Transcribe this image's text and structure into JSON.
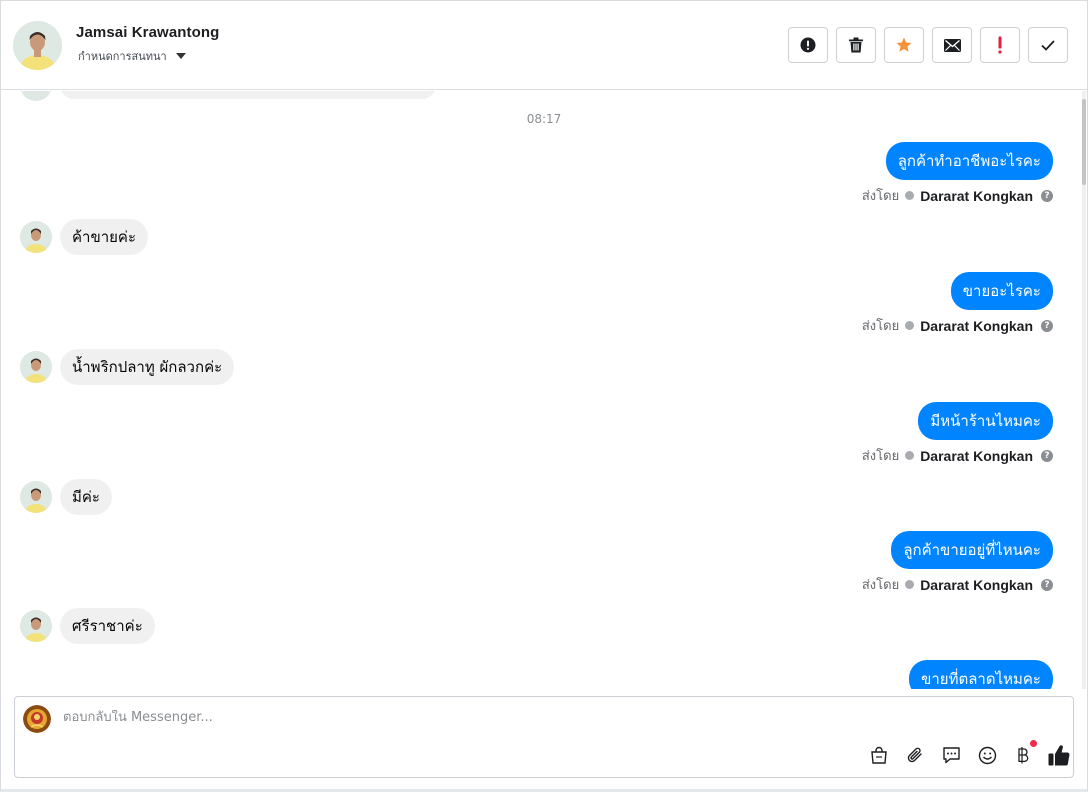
{
  "header": {
    "contact_name": "Jamsai Krawantong",
    "conversation_setting": "กำหนดการสนทนา",
    "actions": [
      {
        "name": "report-spam-button",
        "icon": "alert-circle-icon"
      },
      {
        "name": "delete-button",
        "icon": "trash-icon"
      },
      {
        "name": "star-button",
        "icon": "star-icon"
      },
      {
        "name": "mark-unread-button",
        "icon": "envelope-icon"
      },
      {
        "name": "follow-up-button",
        "icon": "exclamation-icon"
      },
      {
        "name": "mark-done-button",
        "icon": "check-icon"
      }
    ]
  },
  "chat": {
    "timestamp": "08:17",
    "sent_by_label": "ส่งโดย",
    "agent_name": "Dararat Kongkan",
    "help_glyph": "?",
    "messages": [
      {
        "dir": "out",
        "text": "ลูกค้าทำอาชีพอะไรคะ"
      },
      {
        "dir": "in",
        "text": "ค้าขายค่ะ"
      },
      {
        "dir": "out",
        "text": "ขายอะไรคะ"
      },
      {
        "dir": "in",
        "text": "น้ำพริกปลาทู ผักลวกค่ะ"
      },
      {
        "dir": "out",
        "text": "มีหน้าร้านไหมคะ"
      },
      {
        "dir": "in",
        "text": "มีค่ะ"
      },
      {
        "dir": "out",
        "text": "ลูกค้าขายอยู่ที่ไหนคะ"
      },
      {
        "dir": "in",
        "text": "ศรีราชาค่ะ"
      },
      {
        "dir": "out",
        "text": "ขายที่ตลาดไหมคะ"
      }
    ]
  },
  "composer": {
    "placeholder": "ตอบกลับใน Messenger...",
    "tools": [
      "shopping-bag-icon",
      "paperclip-icon",
      "saved-reply-icon",
      "emoji-icon",
      "baht-payment-icon",
      "thumbs-up-icon"
    ]
  },
  "colors": {
    "outgoing_bubble": "#0084ff",
    "incoming_bubble": "#f0f0f0",
    "star": "#f7923b",
    "follow_up": "#e41e3f",
    "notification_dot": "#f02849"
  }
}
